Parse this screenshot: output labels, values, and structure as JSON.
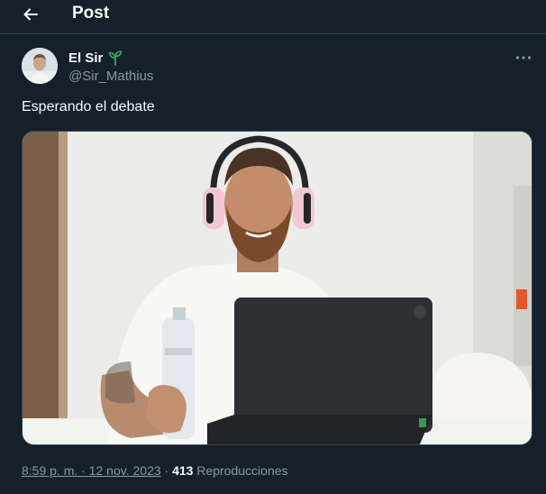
{
  "header": {
    "title": "Post",
    "back_icon": "arrow-left-icon"
  },
  "author": {
    "name": "El Sir",
    "badge_icon": "seedling-icon",
    "badge_color": "#3ba55c",
    "handle": "@Sir_Mathius",
    "more_icon": "more-dots-icon"
  },
  "tweet": {
    "text": "Esperando el debate"
  },
  "media": {
    "kind": "photo",
    "subject_icon": "man-with-headphones-and-laptop"
  },
  "meta": {
    "time": "8:59 p. m.",
    "separator1": " · ",
    "date": "12 nov. 2023",
    "separator2": " · ",
    "views_count": "413",
    "views_label": " Reproducciones"
  },
  "colors": {
    "background": "#15202b",
    "text_primary": "#f7f9f9",
    "text_secondary": "#8b98a5",
    "divider": "#38444d"
  }
}
